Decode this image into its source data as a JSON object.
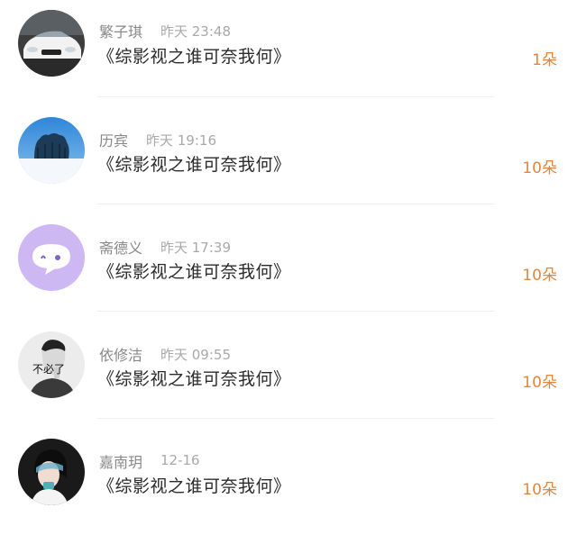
{
  "gift_list": {
    "items": [
      {
        "name": "繁子琪",
        "time": "昨天 23:48",
        "title": "《综影视之谁可奈我何》",
        "count": "1朵",
        "avatar_icon": "car-avatar-icon"
      },
      {
        "name": "历宾",
        "time": "昨天 19:16",
        "title": "《综影视之谁可奈我何》",
        "count": "10朵",
        "avatar_icon": "snow-trees-avatar-icon"
      },
      {
        "name": "斋德义",
        "time": "昨天 17:39",
        "title": "《综影视之谁可奈我何》",
        "count": "10朵",
        "avatar_icon": "chat-bubble-avatar-icon"
      },
      {
        "name": "依修洁",
        "time": "昨天 09:55",
        "title": "《综影视之谁可奈我何》",
        "count": "10朵",
        "avatar_icon": "person-avatar-icon"
      },
      {
        "name": "嘉南玥",
        "time": "12-16",
        "title": "《综影视之谁可奈我何》",
        "count": "10朵",
        "avatar_icon": "portrait-avatar-icon"
      }
    ],
    "avatar_text": "不必了"
  },
  "colors": {
    "name": "#888888",
    "time": "#a9a9a9",
    "title": "#2b2b2b",
    "count": "#e2873f",
    "divider": "#efefef",
    "bubble_bg": "#cdb8f3"
  }
}
